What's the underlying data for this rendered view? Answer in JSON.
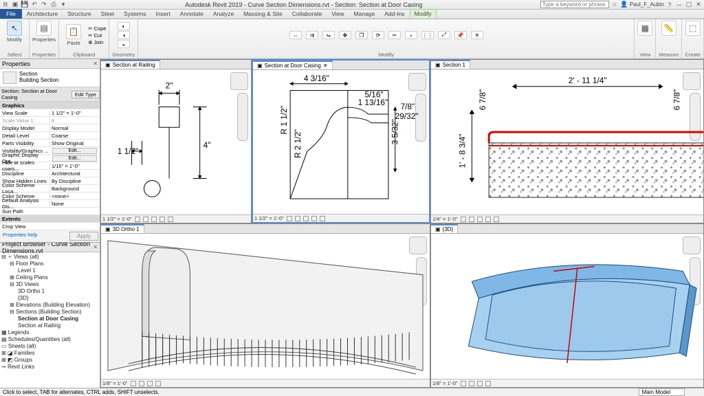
{
  "app": {
    "title": "Autodesk Revit 2019 - Curve Section Dimensions.rvt - Section: Section at Door Casing",
    "search_placeholder": "Type a keyword or phrase",
    "username": "Paul_F_Aubin"
  },
  "ribbon": {
    "tabs": [
      "File",
      "Architecture",
      "Structure",
      "Steel",
      "Systems",
      "Insert",
      "Annotate",
      "Analyze",
      "Massing & Site",
      "Collaborate",
      "View",
      "Manage",
      "Add-Ins",
      "Modify"
    ],
    "active_tab": "Modify",
    "panels": {
      "select": {
        "label": "Select",
        "btn": "Modify"
      },
      "properties": {
        "label": "Properties",
        "btn": "Properties"
      },
      "clipboard": {
        "label": "Clipboard",
        "paste": "Paste",
        "cope": "Cope",
        "cut": "Cut",
        "join": "Join"
      },
      "geometry": {
        "label": "Geometry"
      },
      "modify": {
        "label": "Modify"
      },
      "view": {
        "label": "View"
      },
      "measure": {
        "label": "Measure"
      },
      "create": {
        "label": "Create"
      }
    }
  },
  "properties": {
    "title": "Properties",
    "type_family": "Section",
    "type_name": "Building Section",
    "selector": "Section: Section at Door Casing",
    "edit_type_btn": "Edit Type",
    "group_graphics": "Graphics",
    "rows": [
      {
        "k": "View Scale",
        "v": "1 1/2\" = 1'-0\""
      },
      {
        "k": "Scale Value    1:",
        "v": "8"
      },
      {
        "k": "Display Model",
        "v": "Normal"
      },
      {
        "k": "Detail Level",
        "v": "Coarse"
      },
      {
        "k": "Parts Visibility",
        "v": "Show Original"
      },
      {
        "k": "Visibility/Graphics ...",
        "v": "Edit..."
      },
      {
        "k": "Graphic Display Opt...",
        "v": "Edit..."
      },
      {
        "k": "Hide at scales coars...",
        "v": "1/16\" = 1'-0\""
      },
      {
        "k": "Discipline",
        "v": "Architectural"
      },
      {
        "k": "Show Hidden Lines",
        "v": "By Discipline"
      },
      {
        "k": "Color Scheme Loca...",
        "v": "Background"
      },
      {
        "k": "Color Scheme",
        "v": "<none>"
      },
      {
        "k": "Default Analysis Dis...",
        "v": "None"
      },
      {
        "k": "Sun Path",
        "v": ""
      }
    ],
    "group_extents": "Extents",
    "crop_view": "Crop View",
    "help": "Properties help",
    "apply": "Apply"
  },
  "browser": {
    "title": "Project Browser - Curve Section Dimensions.rvt",
    "nodes": {
      "views": "Views (all)",
      "floorplans": "Floor Plans",
      "level1": "Level 1",
      "ceiling": "Ceiling Plans",
      "3dviews": "3D Views",
      "3dortho": "3D Ortho 1",
      "threed": "{3D}",
      "elev": "Elevations (Building Elevation)",
      "sections": "Sections (Building Section)",
      "sec_door": "Section at Door Casing",
      "sec_rail": "Section at Railing",
      "legends": "Legends",
      "sched": "Schedules/Quantities (all)",
      "sheets": "Sheets (all)",
      "families": "Families",
      "groups": "Groups",
      "links": "Revit Links"
    }
  },
  "viewports": {
    "v1": {
      "tab": "Section at Railing",
      "scale": "1 1/2\" = 1'-0\"",
      "dims": {
        "a": "2\"",
        "b": "1 1/2\"",
        "c": "4\""
      }
    },
    "v2": {
      "tab": "Section at Door Casing",
      "scale": "1 1/2\" = 1'-0\"",
      "dims": {
        "a": "4 3/16\"",
        "b": "5/16\"",
        "c": "1 13/16\"",
        "d": "7/8\"",
        "e": "29/32\"",
        "f": "3 5/32\"",
        "g": "R 1 1/2\"",
        "h": "R 2 1/2\""
      }
    },
    "v3": {
      "tab": "Section 1",
      "scale": "1/4\" = 1'-0\"",
      "dims": {
        "a": "6 7/8\"",
        "b": "2' - 11 1/4\"",
        "c": "6 7/8\"",
        "d": "1' - 8 3/4\""
      }
    },
    "v4": {
      "tab": "3D Ortho 1",
      "scale": "1/8\" = 1'-0\""
    },
    "v5": {
      "tab": "{3D}",
      "scale": "1/8\" = 1'-0\""
    }
  },
  "status": {
    "hint": "Click to select, TAB for alternates, CTRL adds, SHIFT unselects.",
    "main_model": "Main Model"
  }
}
